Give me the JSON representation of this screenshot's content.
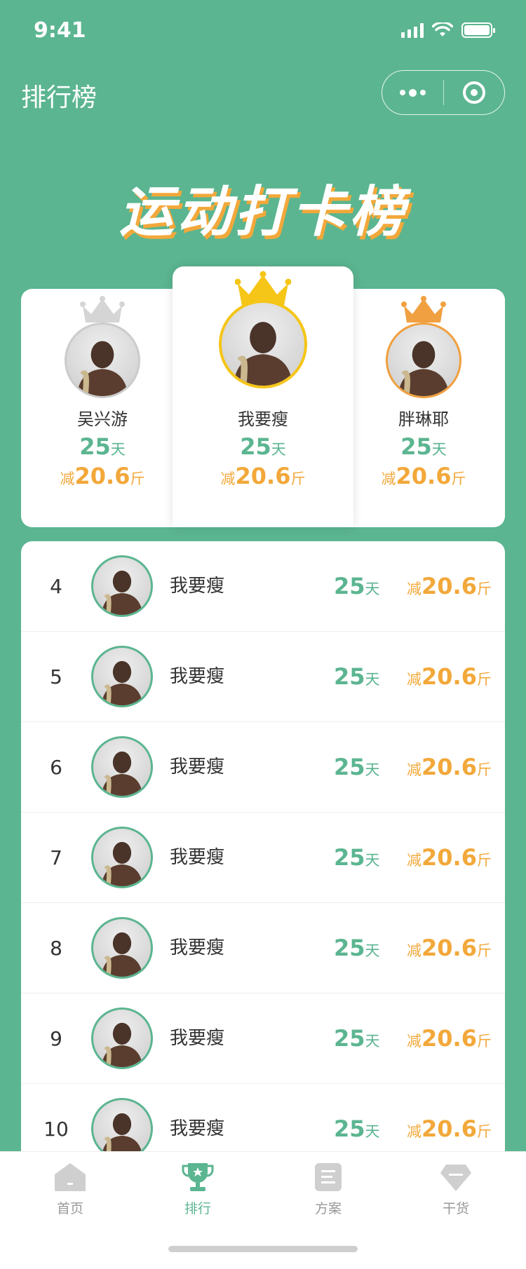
{
  "status_bar": {
    "time": "9:41"
  },
  "nav": {
    "title": "排行榜"
  },
  "hero": {
    "title": "运动打卡榜"
  },
  "podium": [
    {
      "rank": 2,
      "name": "吴兴游",
      "days": "25",
      "days_unit": "天",
      "loss_prefix": "减",
      "loss": "20.6",
      "loss_unit": "斤",
      "crown_color": "#D5D5D5"
    },
    {
      "rank": 1,
      "name": "我要瘦",
      "days": "25",
      "days_unit": "天",
      "loss_prefix": "减",
      "loss": "20.6",
      "loss_unit": "斤",
      "crown_color": "#F5C518"
    },
    {
      "rank": 3,
      "name": "胖琳耶",
      "days": "25",
      "days_unit": "天",
      "loss_prefix": "减",
      "loss": "20.6",
      "loss_unit": "斤",
      "crown_color": "#F0A040"
    }
  ],
  "list": [
    {
      "rank": "4",
      "name": "我要瘦",
      "days": "25",
      "days_unit": "天",
      "loss_prefix": "减",
      "loss": "20.6",
      "loss_unit": "斤"
    },
    {
      "rank": "5",
      "name": "我要瘦",
      "days": "25",
      "days_unit": "天",
      "loss_prefix": "减",
      "loss": "20.6",
      "loss_unit": "斤"
    },
    {
      "rank": "6",
      "name": "我要瘦",
      "days": "25",
      "days_unit": "天",
      "loss_prefix": "减",
      "loss": "20.6",
      "loss_unit": "斤"
    },
    {
      "rank": "7",
      "name": "我要瘦",
      "days": "25",
      "days_unit": "天",
      "loss_prefix": "减",
      "loss": "20.6",
      "loss_unit": "斤"
    },
    {
      "rank": "8",
      "name": "我要瘦",
      "days": "25",
      "days_unit": "天",
      "loss_prefix": "减",
      "loss": "20.6",
      "loss_unit": "斤"
    },
    {
      "rank": "9",
      "name": "我要瘦",
      "days": "25",
      "days_unit": "天",
      "loss_prefix": "减",
      "loss": "20.6",
      "loss_unit": "斤"
    },
    {
      "rank": "10",
      "name": "我要瘦",
      "days": "25",
      "days_unit": "天",
      "loss_prefix": "减",
      "loss": "20.6",
      "loss_unit": "斤"
    }
  ],
  "tabs": [
    {
      "label": "首页",
      "icon": "home-icon",
      "active": false
    },
    {
      "label": "排行",
      "icon": "trophy-icon",
      "active": true
    },
    {
      "label": "方案",
      "icon": "document-icon",
      "active": false
    },
    {
      "label": "干货",
      "icon": "diamond-icon",
      "active": false
    }
  ],
  "colors": {
    "primary": "#5BB590",
    "accent": "#F2A83A"
  }
}
